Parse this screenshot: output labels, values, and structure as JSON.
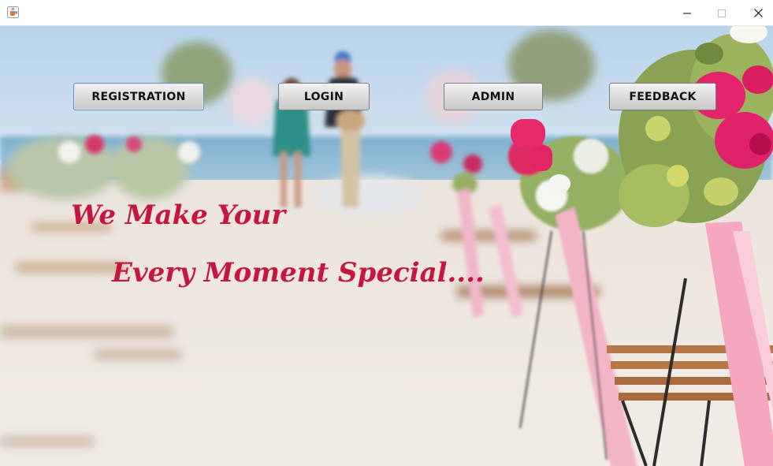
{
  "window": {
    "icon": "java-cup-icon",
    "controls": {
      "minimize": "minimize-icon",
      "maximize": "maximize-icon",
      "close": "close-icon"
    }
  },
  "nav": {
    "registration_label": "REGISTRATION",
    "login_label": "LOGIN",
    "admin_label": "ADMIN",
    "feedback_label": "FEEDBACK"
  },
  "tagline": {
    "line1": "We Make Your",
    "line2": "Every Moment Special...."
  },
  "colors": {
    "tagline": "#c4163f",
    "button_face": "#dcdcdc",
    "focus_border": "#6b8fb5"
  }
}
